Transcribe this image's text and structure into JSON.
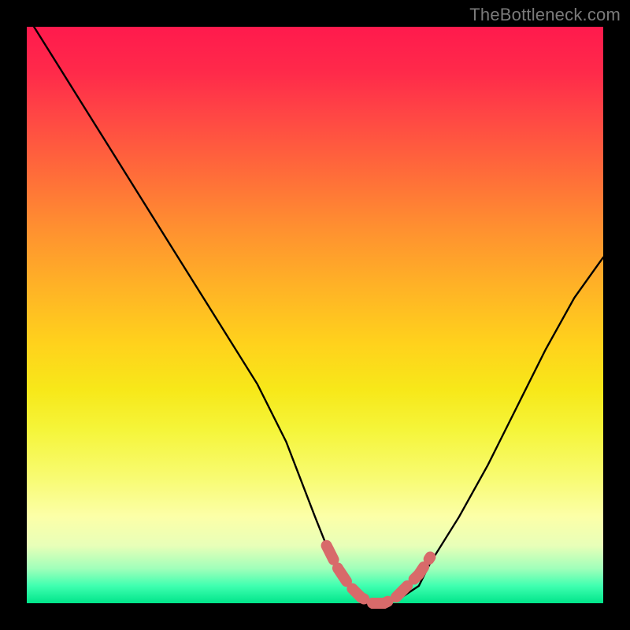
{
  "watermark": "TheBottleneck.com",
  "chart_data": {
    "type": "line",
    "title": "",
    "xlabel": "",
    "ylabel": "",
    "xlim": [
      0,
      100
    ],
    "ylim": [
      0,
      100
    ],
    "grid": false,
    "legend": false,
    "series": [
      {
        "name": "bottleneck-curve",
        "color": "#000000",
        "x": [
          0,
          5,
          10,
          15,
          20,
          25,
          30,
          35,
          40,
          45,
          50,
          52,
          55,
          58,
          60,
          62,
          65,
          68,
          70,
          75,
          80,
          85,
          90,
          95,
          100
        ],
        "values": [
          102,
          94,
          86,
          78,
          70,
          62,
          54,
          46,
          38,
          28,
          15,
          10,
          4,
          1,
          0,
          0,
          1,
          3,
          7,
          15,
          24,
          34,
          44,
          53,
          60
        ]
      },
      {
        "name": "optimal-zone-marker",
        "color": "#d86a6a",
        "x": [
          52,
          54,
          56,
          58,
          60,
          62,
          64,
          66,
          68,
          70
        ],
        "values": [
          10,
          6,
          3,
          1,
          0,
          0,
          1,
          3,
          5,
          8
        ]
      }
    ],
    "background_gradient_stops": [
      {
        "pos": 0,
        "color": "#ff1a4d"
      },
      {
        "pos": 50,
        "color": "#ffd21c"
      },
      {
        "pos": 90,
        "color": "#fcffa8"
      },
      {
        "pos": 100,
        "color": "#00e58a"
      }
    ]
  }
}
